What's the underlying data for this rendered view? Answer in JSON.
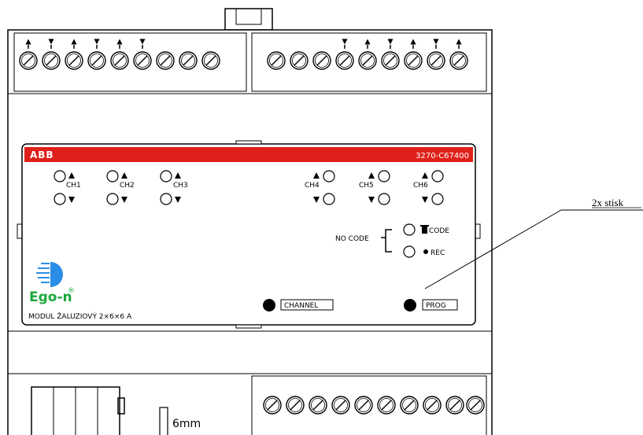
{
  "brand": "ABB",
  "order_code": "3270-C67400",
  "channels": {
    "left": [
      "CH1",
      "CH2",
      "CH3"
    ],
    "right": [
      "CH4",
      "CH5",
      "CH6"
    ]
  },
  "code_group": {
    "no_code_label": "NO CODE",
    "code_label": "CODE",
    "rec_label": "REC"
  },
  "logo_text": "Ego-n",
  "logo_mark": "®",
  "module_name": "MODUL ŽALUZIOVÝ 2×6×6 A",
  "buttons": {
    "channel_label": "CHANNEL",
    "prog_label": "PROG"
  },
  "annotation": "2x stisk",
  "dimension_label": "6mm",
  "colors": {
    "red_band": "#e0201b",
    "line": "#000000"
  }
}
